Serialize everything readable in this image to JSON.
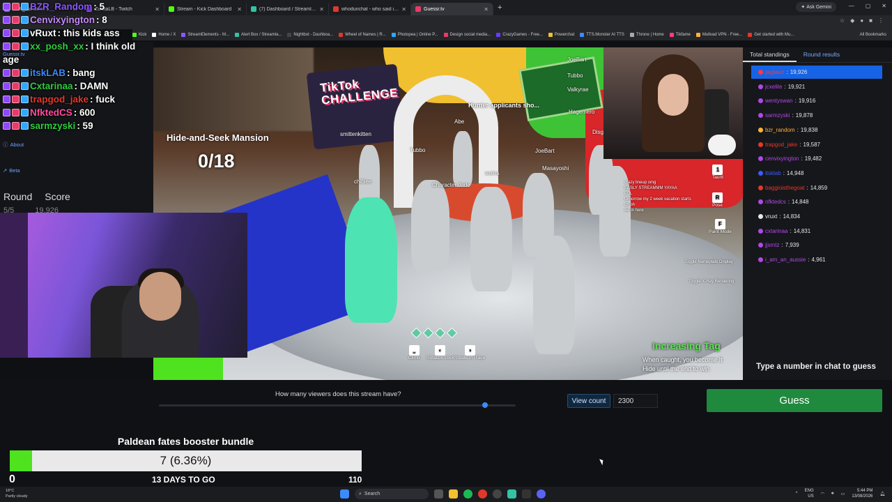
{
  "browser": {
    "tabs": [
      {
        "label": "BZR_Random: 5",
        "color": "#8b57ff"
      },
      {
        "label": "ZuletaLB - Twitch",
        "color": "#9146ff"
      },
      {
        "label": "Stream - Kick Dashboard",
        "color": "#53fc18"
      },
      {
        "label": "(7) Dashboard / Streamlabs",
        "color": "#31c3a2"
      },
      {
        "label": "whodunchat - who said it in yo",
        "color": "#e0392b"
      },
      {
        "label": "Guessr.tv",
        "color": "#e83b6a"
      }
    ],
    "ask_gemini": "Ask Gemini",
    "bookmarks": [
      "Kick",
      "Home / X",
      "StreamElements - M...",
      "Alert Box / Streamla...",
      "Nightbot - Dashboa...",
      "Wheel of Names | R...",
      "Photopea | Online P...",
      "Design social media...",
      "CrazyGames - Free...",
      "Powerchat",
      "TTS.Monster AI TTS",
      "Throne | Home",
      "Tikfame",
      "Mullvad VPN - Free...",
      "Get started with Mu..."
    ],
    "all_bookmarks": "All Bookmarks"
  },
  "chat": [
    {
      "user": "BZR_Random",
      "msg": ": 5",
      "color": "#8b57ff"
    },
    {
      "user": "Cenvixyington",
      "msg": ": 8",
      "color": "#c58af9"
    },
    {
      "user": "vRuxt",
      "msg": ": this kids ass",
      "color": "#ffffff"
    },
    {
      "user": "xx_posh_xx",
      "msg": ": I think old",
      "color": "#2ecc40"
    },
    {
      "user": "age",
      "msg": "",
      "color": "#ffffff"
    },
    {
      "user": "itskLAB",
      "msg": ": bang",
      "color": "#3b8bff"
    },
    {
      "user": "Cxtarinaa",
      "msg": ": DAMN",
      "color": "#2ecc40"
    },
    {
      "user": "trapgod_jake",
      "msg": ": fuck",
      "color": "#e0392b"
    },
    {
      "user": "NfktedCS",
      "msg": ": 600",
      "color": "#ff4d9a"
    },
    {
      "user": "sarmzyski",
      "msg": ": 59",
      "color": "#2ecc40"
    }
  ],
  "sidebar": {
    "site": "Guessr.tv",
    "about": "About",
    "beta": "Beta",
    "round_label": "Round",
    "score_label": "Score",
    "round_value": "5/5",
    "score_value": "19,926"
  },
  "game": {
    "room_name": "Hide-and-Seek Mansion",
    "found": "0/18",
    "sign": "TikTok CHALLENGE",
    "hunter_text": "Hunter applicants sho...",
    "names": [
      "smittenkitten",
      "Abe",
      "JoeBart",
      "Disguised",
      "Tubbo",
      "chiblee",
      "Character Jade",
      "weins",
      "Masayoshi",
      "JoeBart",
      "Tubbo",
      "Valkyrae",
      "Hagemero"
    ],
    "keys": {
      "taunt": "Taunt",
      "pose": "Pose",
      "paint": "Paint Mode",
      "nameplate": "Toggle Nameplate Display",
      "xray": "Toggle X-Ray Rendering",
      "climb": "Climb",
      "rot_lock": "Rotation Lock",
      "rot_place": "Rotate in Place"
    },
    "ingame_chat": [
      "crazy lineup omg",
      "EASLY STREAMMM YAYAA",
      "LOL",
      "tomorrow my 2 week vacation starts",
      "uh oh",
      "we in here"
    ],
    "mode_title": "Increasing Tag",
    "mode_line1": "When caught, you become It",
    "mode_line2": "Hide until the end to win"
  },
  "standings": {
    "tab_total": "Total standings",
    "tab_round": "Round results",
    "rows": [
      {
        "name": "jaypauz",
        "score": "19,926",
        "color": "#ff3b3b",
        "selected": true
      },
      {
        "name": "jcxelite",
        "score": "19,921",
        "color": "#b048e8"
      },
      {
        "name": "wentyswan",
        "score": "19,916",
        "color": "#b048e8"
      },
      {
        "name": "sarmzyski",
        "score": "19,878",
        "color": "#b048e8"
      },
      {
        "name": "bzr_random",
        "score": "19,838",
        "color": "#ffb03b"
      },
      {
        "name": "trapgod_jake",
        "score": "19,587",
        "color": "#e0392b"
      },
      {
        "name": "cenvixyington",
        "score": "19,482",
        "color": "#b048e8"
      },
      {
        "name": "itsklab",
        "score": "14,948",
        "color": "#3b5bff"
      },
      {
        "name": "baggioisthegoat",
        "score": "14,859",
        "color": "#e0392b"
      },
      {
        "name": "nfktedcs",
        "score": "14,848",
        "color": "#b048e8"
      },
      {
        "name": "vruxt",
        "score": "14,834",
        "color": "#e6e6e6"
      },
      {
        "name": "cxtarinaa",
        "score": "14,831",
        "color": "#b048e8"
      },
      {
        "name": "jjsmtz",
        "score": "7,939",
        "color": "#b048e8"
      },
      {
        "name": "i_am_an_aussie",
        "score": "4,961",
        "color": "#b048e8"
      }
    ],
    "type_hint": "Type a number in chat to guess"
  },
  "guess": {
    "question": "How many viewers does this stream have?",
    "slider_fraction": 0.92,
    "view_count_label": "View count",
    "view_count_value": "2300",
    "guess_label": "Guess"
  },
  "goal": {
    "title": "Paldean fates booster bundle",
    "progress_text": "7 (6.36%)",
    "progress_fraction": 0.0636,
    "min": "0",
    "days": "13 DAYS TO GO",
    "max": "110"
  },
  "taskbar": {
    "temp": "18°C",
    "weather": "Partly cloudy",
    "search": "Search",
    "lang1": "ENG",
    "lang2": "US",
    "time": "5:44 PM",
    "date": "13/08/2026"
  }
}
